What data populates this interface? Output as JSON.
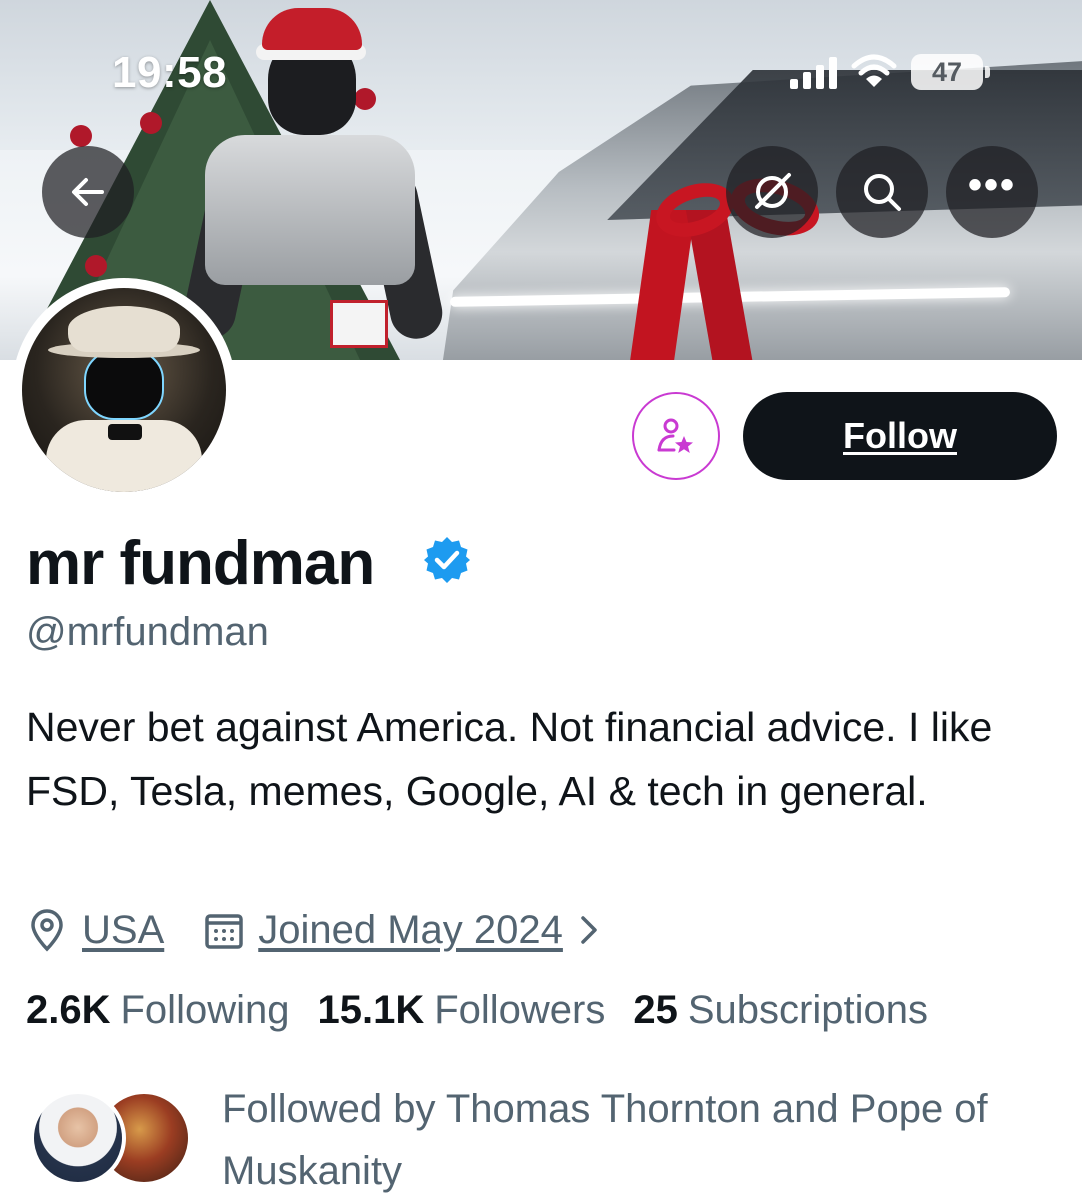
{
  "status_bar": {
    "time": "19:58",
    "battery": "47"
  },
  "banner": {
    "description_icons": [
      "back-arrow-icon",
      "grok-icon",
      "search-icon",
      "more-icon"
    ]
  },
  "profile": {
    "display_name": "mr fundman",
    "handle": "@mrfundman",
    "bio": "Never bet against America. Not financial advice. I like FSD, Tesla, memes, Google, AI & tech in general.",
    "location": "USA",
    "joined": "Joined May 2024",
    "verified": true
  },
  "actions": {
    "follow_label": "Follow"
  },
  "stats": {
    "following_count": "2.6K",
    "following_label": "Following",
    "followers_count": "15.1K",
    "followers_label": "Followers",
    "subscriptions_count": "25",
    "subscriptions_label": "Subscriptions"
  },
  "followed_by": {
    "text": "Followed by Thomas Thornton and Pope of Muskanity"
  },
  "colors": {
    "accent_blue": "#1d9bf0",
    "subscribe_purple": "#c93ad2",
    "text_primary": "#0f1419",
    "text_secondary": "#536471"
  }
}
